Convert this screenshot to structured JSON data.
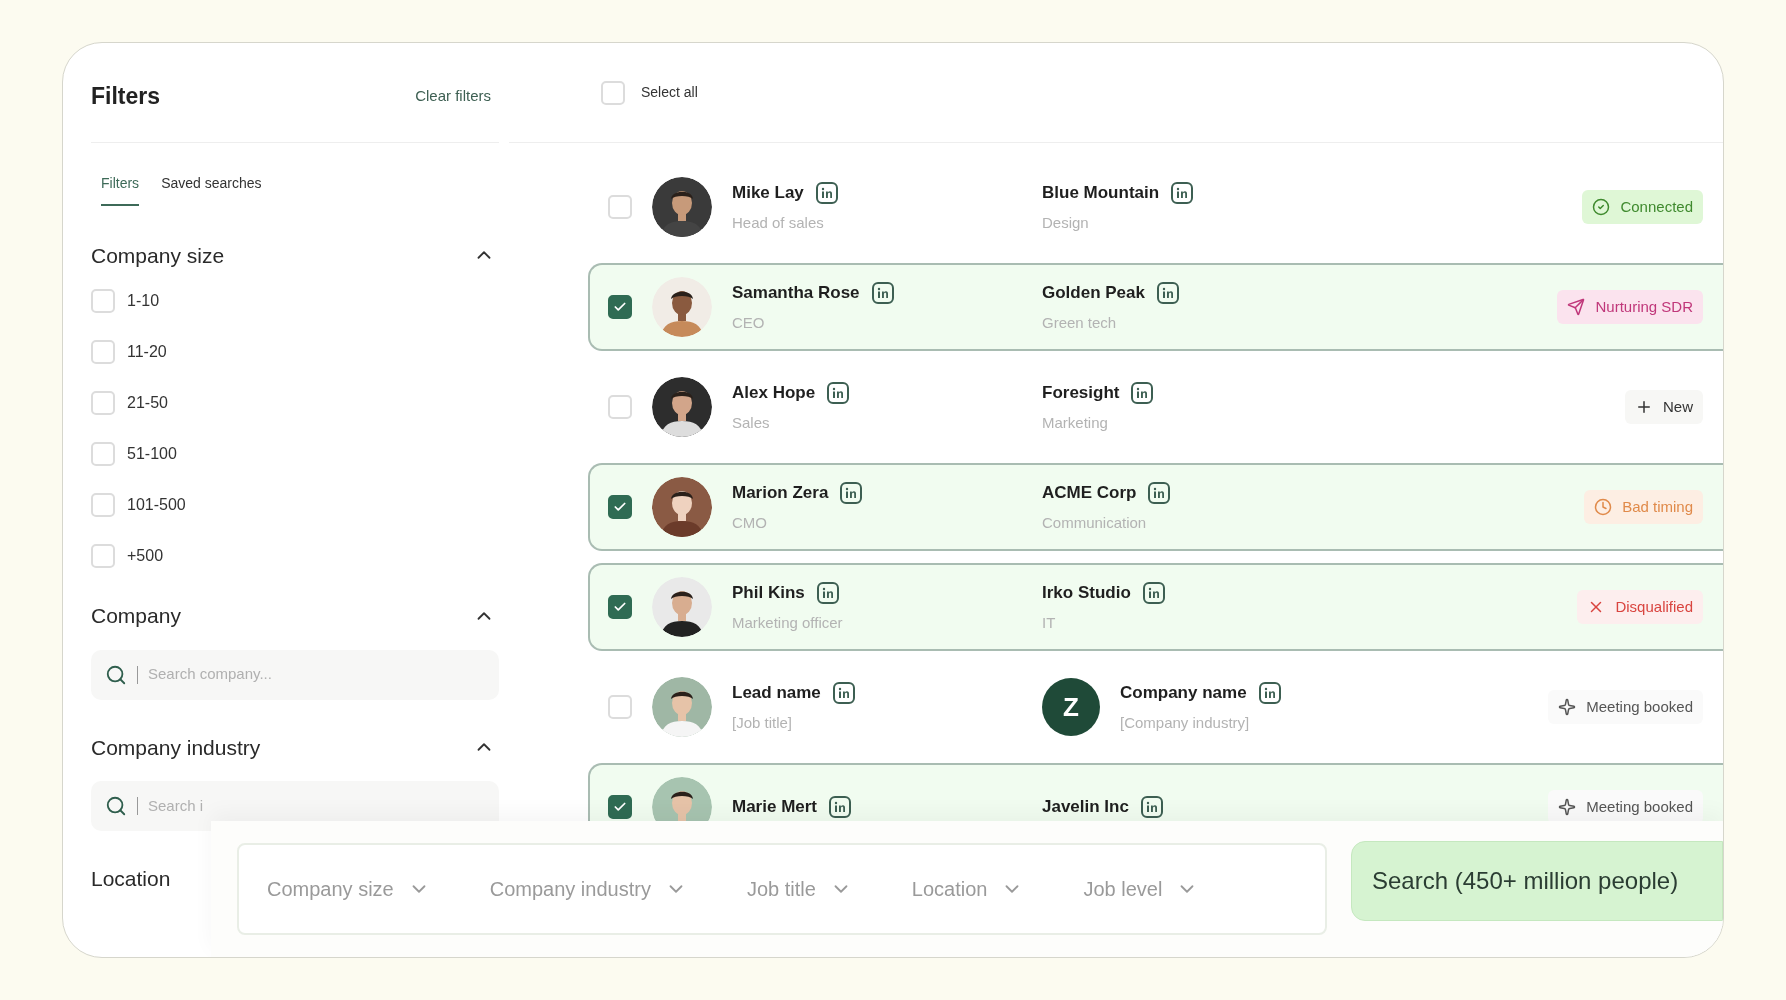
{
  "sidebar": {
    "title": "Filters",
    "clear_link": "Clear filters",
    "tabs": [
      {
        "label": "Filters",
        "selected": true
      },
      {
        "label": "Saved searches",
        "selected": false
      }
    ],
    "sections": [
      {
        "kind": "checkboxes",
        "title": "Company size",
        "expanded": true,
        "options": [
          {
            "label": "1-10",
            "checked": false
          },
          {
            "label": "11-20",
            "checked": false
          },
          {
            "label": "21-50",
            "checked": false
          },
          {
            "label": "51-100",
            "checked": false
          },
          {
            "label": "101-500",
            "checked": false
          },
          {
            "label": "+500",
            "checked": false
          }
        ]
      },
      {
        "kind": "search",
        "title": "Company",
        "expanded": true,
        "placeholder": "Search company..."
      },
      {
        "kind": "search",
        "title": "Company industry",
        "expanded": true,
        "placeholder": "Search i"
      },
      {
        "kind": "heading",
        "title": "Location"
      }
    ]
  },
  "list": {
    "select_all": {
      "label": "Select all",
      "checked": false
    },
    "rows": [
      {
        "selected": false,
        "name": "Mike Lay",
        "title": "Head of sales",
        "company": "Blue Mountain",
        "industry": "Design",
        "status": {
          "kind": "connected",
          "label": "Connected"
        }
      },
      {
        "selected": true,
        "name": "Samantha Rose",
        "title": "CEO",
        "company": "Golden Peak",
        "industry": "Green tech",
        "status": {
          "kind": "nurturing",
          "label": "Nurturing SDR"
        }
      },
      {
        "selected": false,
        "name": "Alex Hope",
        "title": "Sales",
        "company": "Foresight",
        "industry": "Marketing",
        "status": {
          "kind": "new",
          "label": "New"
        }
      },
      {
        "selected": true,
        "name": "Marion Zera",
        "title": "CMO",
        "company": "ACME Corp",
        "industry": "Communication",
        "status": {
          "kind": "bad_timing",
          "label": "Bad timing"
        }
      },
      {
        "selected": true,
        "name": "Phil Kins",
        "title": "Marketing officer",
        "company": "Irko Studio",
        "industry": "IT",
        "status": {
          "kind": "disqualified",
          "label": "Disqualified"
        }
      },
      {
        "selected": false,
        "name": "Lead name",
        "title": "[Job title]",
        "company": "Company name",
        "industry": "[Company industry]",
        "company_logo": "Z",
        "status": {
          "kind": "meeting",
          "label": "Meeting booked"
        }
      },
      {
        "selected": true,
        "name": "Marie Mert",
        "company": "Javelin Inc",
        "status": {
          "kind": "meeting",
          "label": "Meeting booked"
        }
      }
    ]
  },
  "search_bar": {
    "dropdowns": [
      "Company size",
      "Company industry",
      "Job title",
      "Location",
      "Job level"
    ],
    "button": "Search (450+ million people)"
  }
}
